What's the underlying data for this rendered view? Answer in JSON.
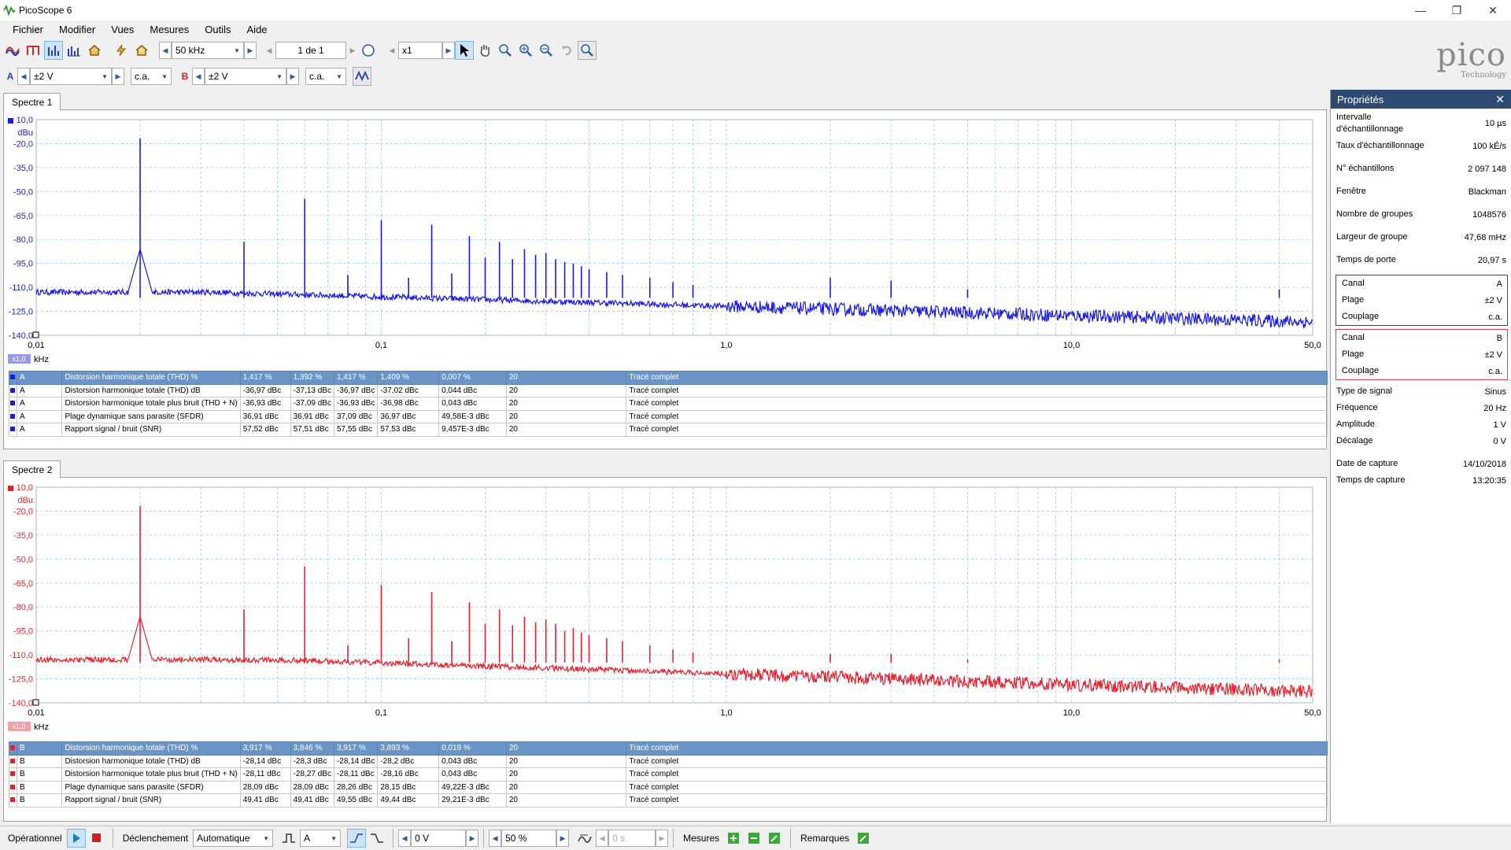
{
  "app": {
    "title": "PicoScope 6"
  },
  "menu": [
    "Fichier",
    "Modifier",
    "Vues",
    "Mesures",
    "Outils",
    "Aide"
  ],
  "toolbar": {
    "timebase": "50 kHz",
    "page": "1 de 1",
    "zoom": "x1"
  },
  "channels": {
    "a_label": "A",
    "a_range": "±2 V",
    "a_coupling": "c.a.",
    "b_label": "B",
    "b_range": "±2 V",
    "b_coupling": "c.a."
  },
  "logo": {
    "word": "pico",
    "sub": "Technology"
  },
  "spectrum1": {
    "tab": "Spectre 1",
    "color": "#1a1ae6",
    "y_unit": "dBu",
    "y_ticks": [
      "10,0",
      "-20,0",
      "-35,0",
      "-50,0",
      "-65,0",
      "-80,0",
      "-95,0",
      "-110,0",
      "-125,0",
      "-140,0"
    ],
    "x_ticks": [
      "0,01",
      "0,1",
      "1,0",
      "10,0",
      "50,0"
    ],
    "x_unit": "kHz",
    "scale": "x1,0",
    "measurements": [
      [
        "A",
        "Distorsion harmonique totale (THD) %",
        "1,417 %",
        "1,392 %",
        "1,417 %",
        "1,409 %",
        "0,007 %",
        "20",
        "Tracé complet"
      ],
      [
        "A",
        "Distorsion harmonique totale (THD) dB",
        "-36,97 dBc",
        "-37,13 dBc",
        "-36,97 dBc",
        "-37,02 dBc",
        "0,044 dBc",
        "20",
        "Tracé complet"
      ],
      [
        "A",
        "Distorsion harmonique totale plus bruit (THD + N)",
        "-36,93 dBc",
        "-37,09 dBc",
        "-36,93 dBc",
        "-36,98 dBc",
        "0,043 dBc",
        "20",
        "Tracé complet"
      ],
      [
        "A",
        "Plage dynamique sans parasite (SFDR)",
        "36,91 dBc",
        "36,91 dBc",
        "37,09 dBc",
        "36,97 dBc",
        "49,58E-3 dBc",
        "20",
        "Tracé complet"
      ],
      [
        "A",
        "Rapport signal / bruit (SNR)",
        "57,52 dBc",
        "57,51 dBc",
        "57,55 dBc",
        "57,53 dBc",
        "9,457E-3 dBc",
        "20",
        "Tracé complet"
      ]
    ]
  },
  "spectrum2": {
    "tab": "Spectre 2",
    "color": "#e8202e",
    "y_unit": "dBu",
    "y_ticks": [
      "10,0",
      "-20,0",
      "-35,0",
      "-50,0",
      "-65,0",
      "-80,0",
      "-95,0",
      "-110,0",
      "-125,0",
      "-140,0"
    ],
    "x_ticks": [
      "0,01",
      "0,1",
      "1,0",
      "10,0",
      "50,0"
    ],
    "x_unit": "kHz",
    "scale": "x1,0",
    "measurements": [
      [
        "B",
        "Distorsion harmonique totale (THD) %",
        "3,917 %",
        "3,846 %",
        "3,917 %",
        "3,893 %",
        "0,019 %",
        "20",
        "Tracé complet"
      ],
      [
        "B",
        "Distorsion harmonique totale (THD) dB",
        "-28,14 dBc",
        "-28,3 dBc",
        "-28,14 dBc",
        "-28,2 dBc",
        "0,043 dBc",
        "20",
        "Tracé complet"
      ],
      [
        "B",
        "Distorsion harmonique totale plus bruit (THD + N)",
        "-28,11 dBc",
        "-28,27 dBc",
        "-28,11 dBc",
        "-28,16 dBc",
        "0,043 dBc",
        "20",
        "Tracé complet"
      ],
      [
        "B",
        "Plage dynamique sans parasite (SFDR)",
        "28,09 dBc",
        "28,09 dBc",
        "28,26 dBc",
        "28,15 dBc",
        "49,22E-3 dBc",
        "20",
        "Tracé complet"
      ],
      [
        "B",
        "Rapport signal / bruit (SNR)",
        "49,41 dBc",
        "49,41 dBc",
        "49,55 dBc",
        "49,44 dBc",
        "29,21E-3 dBc",
        "20",
        "Tracé complet"
      ]
    ]
  },
  "properties": {
    "title": "Propriétés",
    "general": [
      [
        "Intervalle d'échantillonnage",
        "10 µs"
      ],
      [
        "Taux d'échantillonnage",
        "100 kÉ/s"
      ],
      [
        "N° échantillons",
        "2 097 148"
      ],
      [
        "Fenêtre",
        "Blackman"
      ],
      [
        "Nombre de groupes",
        "1048576"
      ],
      [
        "Largeur de groupe",
        "47,68 mHz"
      ],
      [
        "Temps de porte",
        "20,97 s"
      ]
    ],
    "channelA": [
      [
        "Canal",
        "A"
      ],
      [
        "Plage",
        "±2 V"
      ],
      [
        "Couplage",
        "c.a."
      ]
    ],
    "channelB": [
      [
        "Canal",
        "B"
      ],
      [
        "Plage",
        "±2 V"
      ],
      [
        "Couplage",
        "c.a."
      ]
    ],
    "signal": [
      [
        "Type de signal",
        "Sinus"
      ],
      [
        "Fréquence",
        "20 Hz"
      ],
      [
        "Amplitude",
        "1 V"
      ],
      [
        "Décalage",
        "0 V"
      ]
    ],
    "capture": [
      [
        "Date de capture",
        "14/10/2018"
      ],
      [
        "Temps de capture",
        "13:20:35"
      ]
    ]
  },
  "status": {
    "state": "Opérationnel",
    "trigger_label": "Déclenchement",
    "trigger_mode": "Automatique",
    "trigger_source": "A",
    "threshold": "0 V",
    "pretrigger": "50 %",
    "delay": "0 s",
    "measures": "Mesures",
    "notes": "Remarques"
  }
}
